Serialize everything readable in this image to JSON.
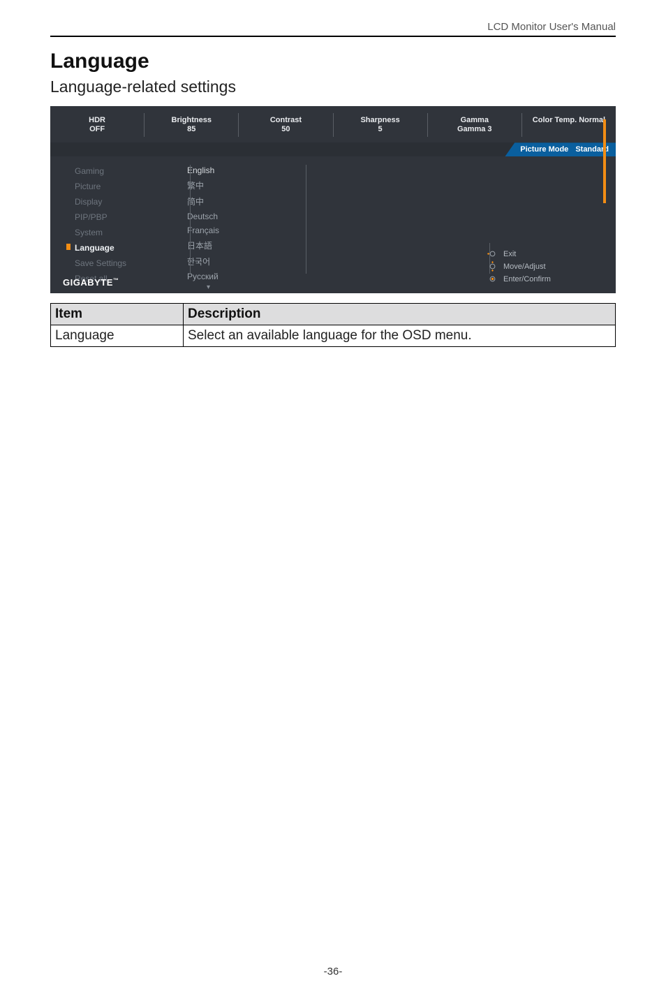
{
  "header": {
    "title": "LCD Monitor User's Manual"
  },
  "headings": {
    "h1": "Language",
    "h2": "Language-related settings"
  },
  "osd": {
    "brand": "GIGABYTE",
    "status": [
      {
        "label": "HDR\nOFF",
        "value": ""
      },
      {
        "label": "Brightness",
        "value": "85"
      },
      {
        "label": "Contrast",
        "value": "50"
      },
      {
        "label": "Sharpness",
        "value": "5"
      },
      {
        "label": "Gamma",
        "value": "Gamma 3"
      },
      {
        "label": "Color Temp. Normal",
        "value": ""
      }
    ],
    "picture_mode": {
      "label": "Picture Mode",
      "value": "Standard"
    },
    "sidebar": [
      {
        "label": "Gaming",
        "active": false
      },
      {
        "label": "Picture",
        "active": false
      },
      {
        "label": "Display",
        "active": false
      },
      {
        "label": "PIP/PBP",
        "active": false
      },
      {
        "label": "System",
        "active": false
      },
      {
        "label": "Language",
        "active": true
      },
      {
        "label": "Save Settings",
        "active": false
      },
      {
        "label": "Reset all",
        "active": false
      }
    ],
    "options": [
      "English",
      "繁中",
      "简中",
      "Deutsch",
      "Français",
      "日本語",
      "한국어",
      "Pyccкий"
    ],
    "hints": [
      {
        "icon": "joystick-left-icon",
        "label": "Exit"
      },
      {
        "icon": "joystick-updown-icon",
        "label": "Move/Adjust"
      },
      {
        "icon": "joystick-press-icon",
        "label": "Enter/Confirm"
      }
    ]
  },
  "table": {
    "headers": [
      "Item",
      "Description"
    ],
    "rows": [
      {
        "item": "Language",
        "desc": "Select an available language for the OSD menu."
      }
    ]
  },
  "pagenum": "-36-"
}
